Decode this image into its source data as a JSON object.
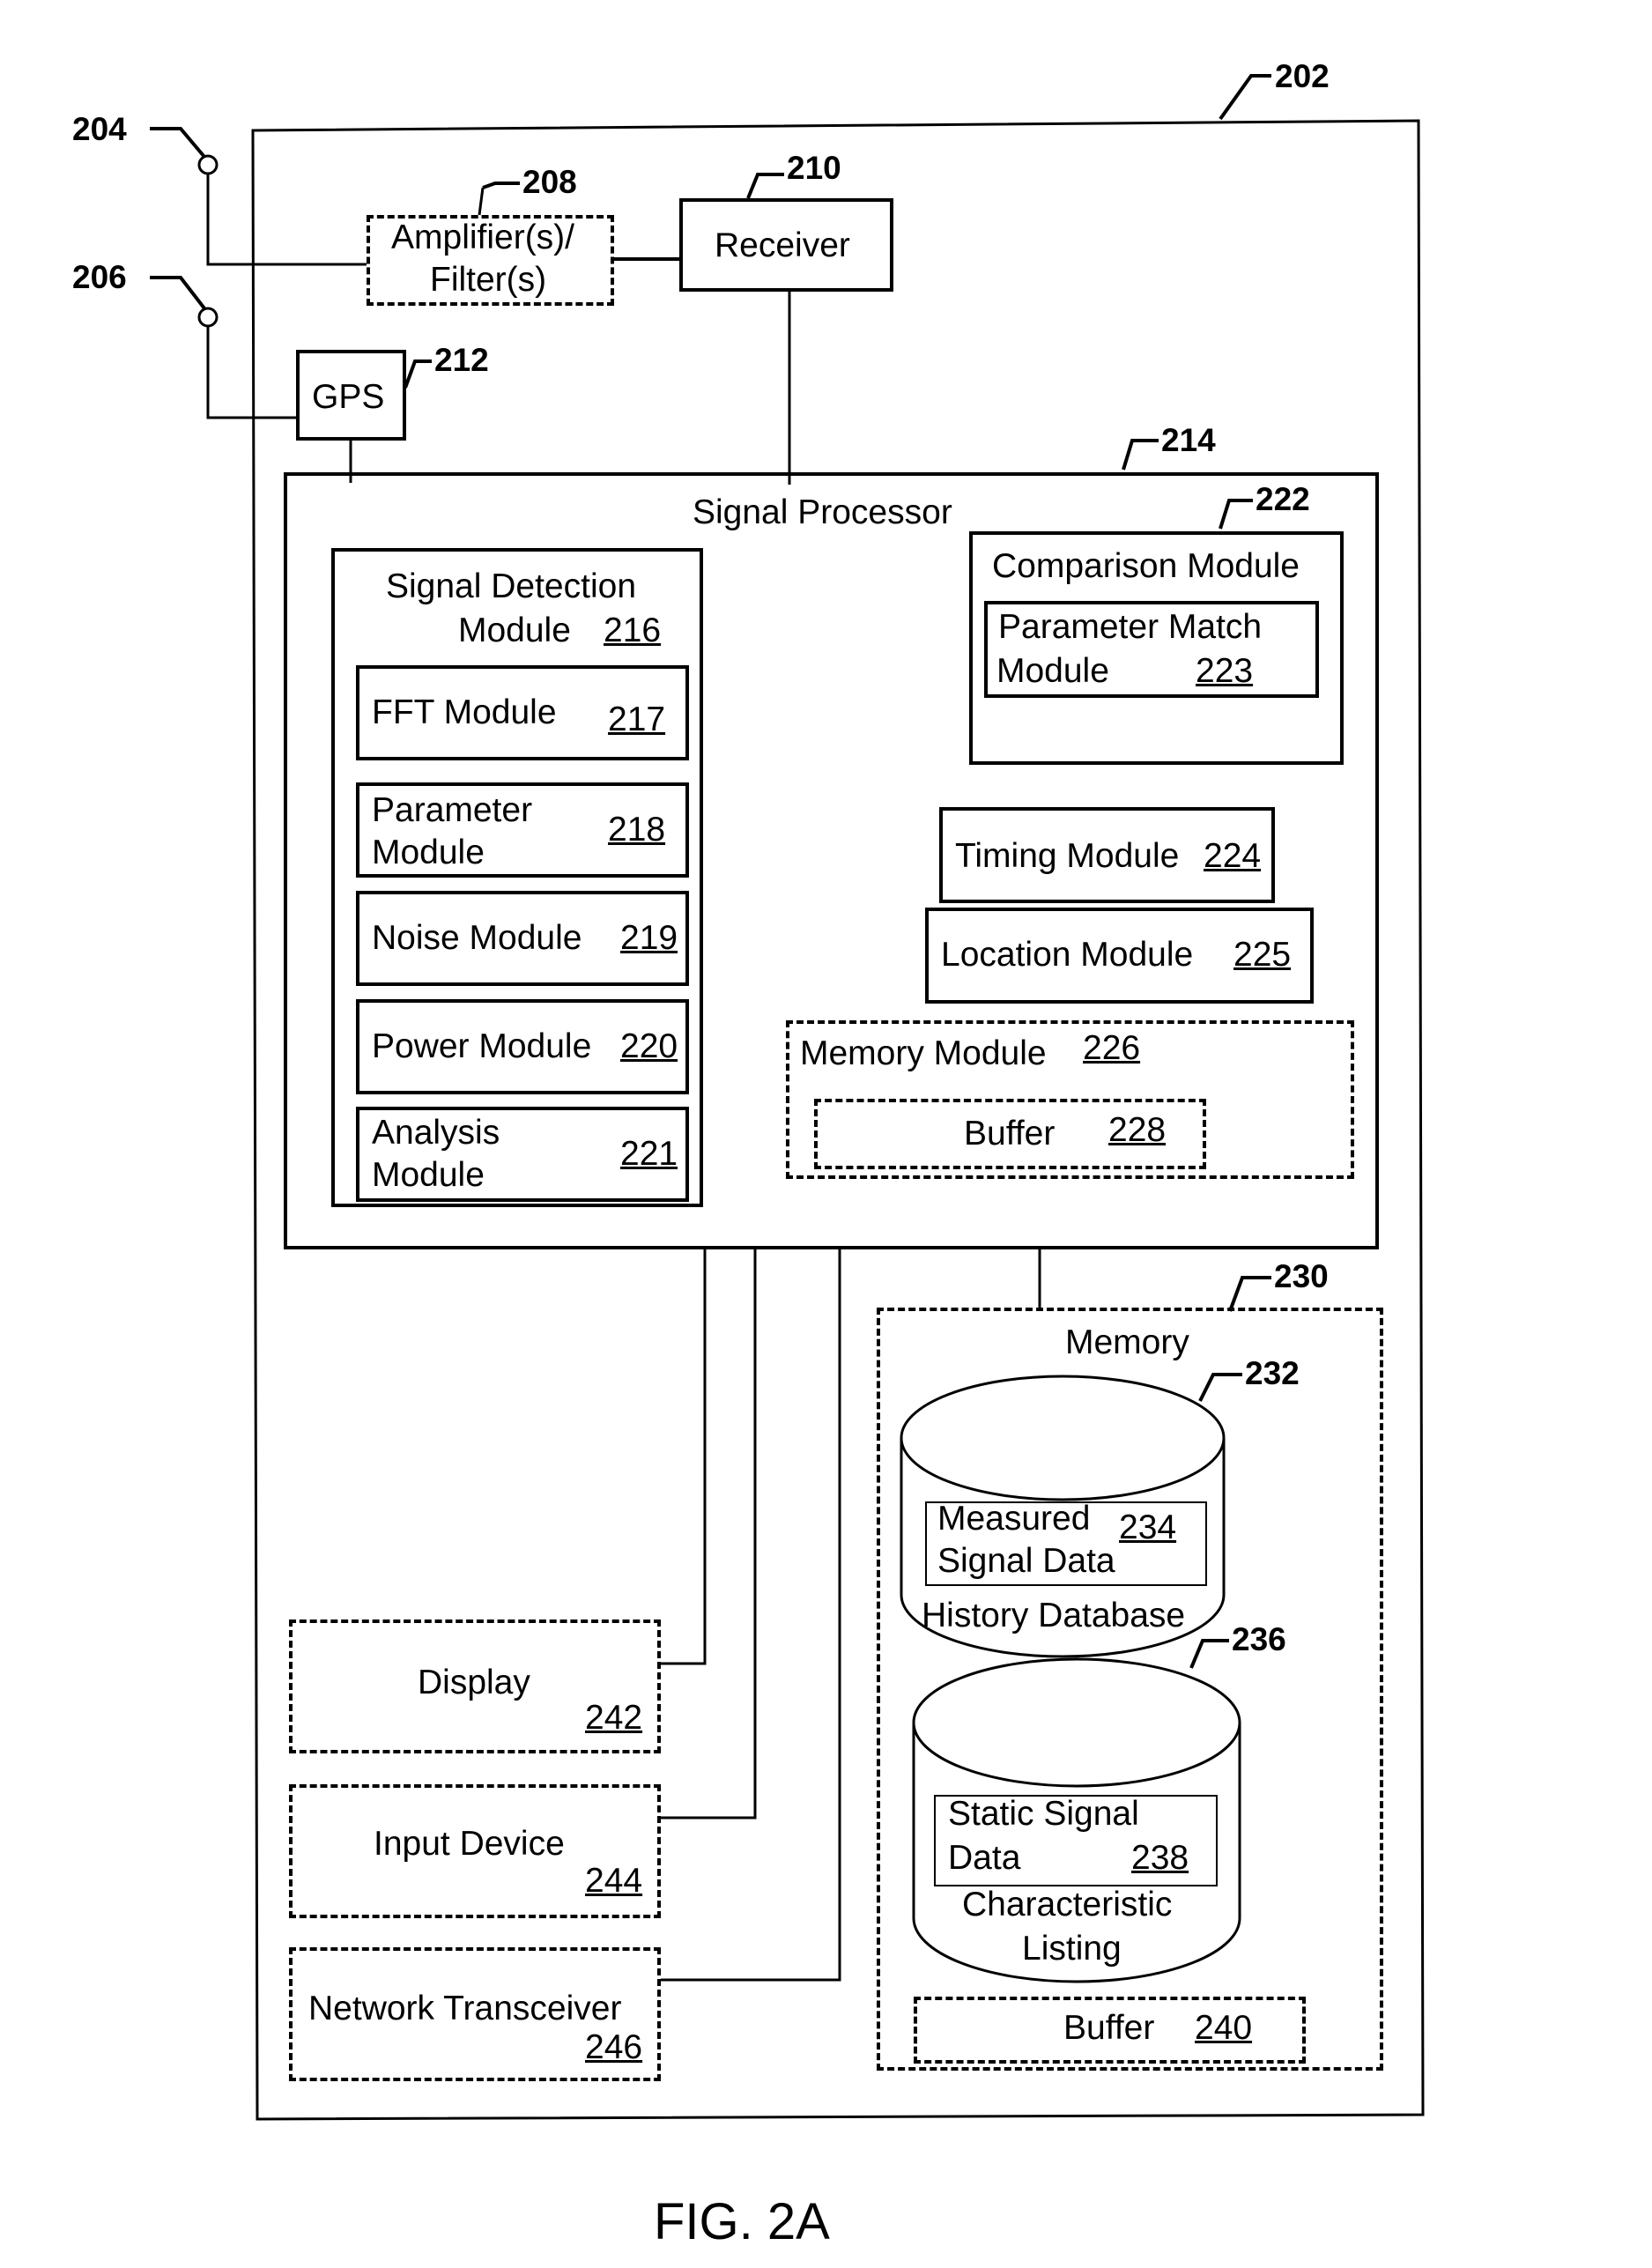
{
  "figure": {
    "caption": "FIG. 2A"
  },
  "callouts": {
    "device": "202",
    "antenna_1": "204",
    "antenna_2": "206",
    "amp_filter": "208",
    "receiver": "210",
    "gps": "212",
    "signal_processor": "214",
    "comparison_module": "222",
    "memory": "230",
    "history_db": "232",
    "characteristic_listing": "236"
  },
  "blocks": {
    "amp_filter": {
      "line1": "Amplifier(s)/",
      "line2": "Filter(s)"
    },
    "receiver": {
      "label": "Receiver"
    },
    "gps": {
      "label": "GPS"
    },
    "signal_processor": {
      "label": "Signal Processor"
    },
    "signal_detection": {
      "line1": "Signal Detection",
      "line2": "Module",
      "ref": "216"
    },
    "fft": {
      "label": "FFT Module",
      "ref": "217"
    },
    "parameter": {
      "line1": "Parameter",
      "line2": "Module",
      "ref": "218"
    },
    "noise": {
      "label": "Noise Module",
      "ref": "219"
    },
    "power": {
      "label": "Power Module",
      "ref": "220"
    },
    "analysis": {
      "line1": "Analysis",
      "line2": "Module",
      "ref": "221"
    },
    "comparison": {
      "label": "Comparison Module"
    },
    "parameter_match": {
      "line1": "Parameter Match",
      "line2": "Module",
      "ref": "223"
    },
    "timing": {
      "label": "Timing Module",
      "ref": "224"
    },
    "location": {
      "label": "Location Module",
      "ref": "225"
    },
    "memory_module": {
      "label": "Memory Module",
      "ref": "226"
    },
    "buffer_228": {
      "label": "Buffer",
      "ref": "228"
    },
    "memory": {
      "label": "Memory"
    },
    "measured_signal": {
      "line1": "Measured",
      "line2": "Signal Data",
      "ref": "234"
    },
    "history_db": {
      "label": "History Database"
    },
    "static_signal": {
      "line1": "Static Signal",
      "line2": "Data",
      "ref": "238"
    },
    "characteristic": {
      "line1": "Characteristic",
      "line2": "Listing"
    },
    "buffer_240": {
      "label": "Buffer",
      "ref": "240"
    },
    "display": {
      "label": "Display",
      "ref": "242"
    },
    "input_device": {
      "label": "Input Device",
      "ref": "244"
    },
    "network": {
      "label": "Network Transceiver",
      "ref": "246"
    }
  }
}
